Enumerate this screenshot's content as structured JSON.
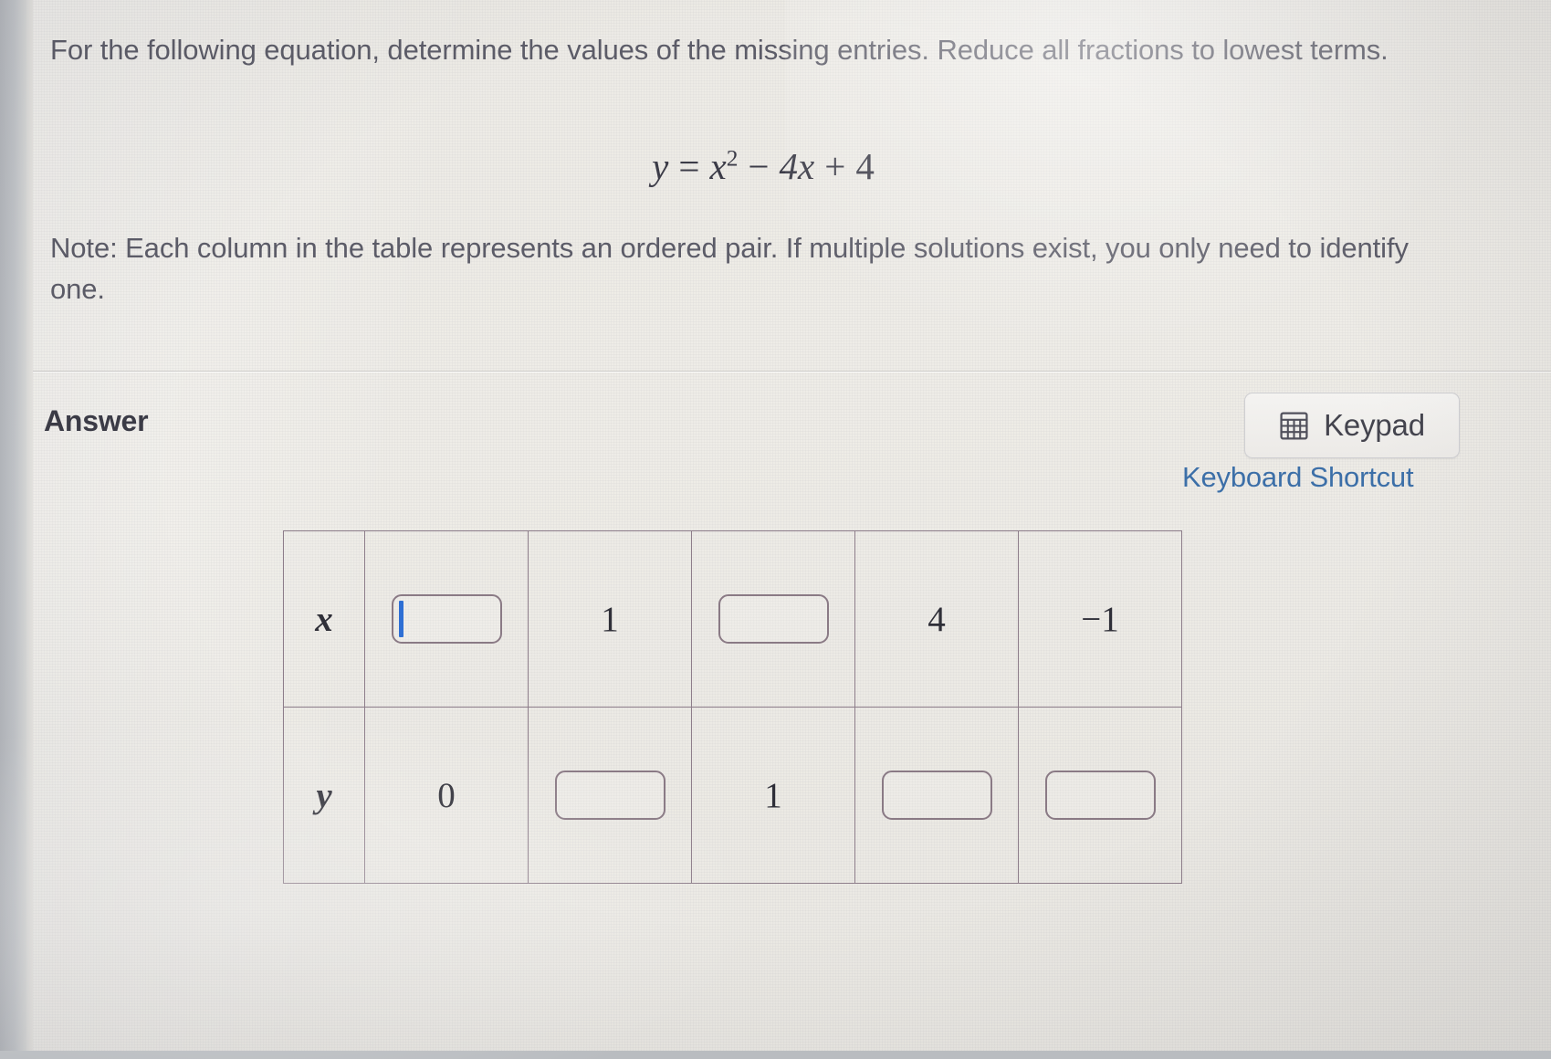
{
  "problem": {
    "instruction": "For the following equation, determine the values of the missing entries. Reduce all fractions to lowest terms.",
    "equation": {
      "lhs": "y",
      "relation": "=",
      "term1_base": "x",
      "term1_exp": "2",
      "op1": "−",
      "term2": "4x",
      "op2": "+",
      "term3": "4",
      "plain": "y = x² − 4x + 4"
    },
    "note": "Note: Each column in the table represents an ordered pair. If multiple solutions exist, you only need to identify one."
  },
  "answer_section": {
    "heading": "Answer",
    "keypad_button": {
      "label": "Keypad",
      "icon": "keypad-grid-icon"
    },
    "keyboard_shortcut_link": "Keyboard Shortcut"
  },
  "table": {
    "row_labels": [
      "x",
      "y"
    ],
    "rows": [
      {
        "label": "x",
        "cells": [
          {
            "type": "input",
            "value": "",
            "focused": true
          },
          {
            "type": "text",
            "value": "1"
          },
          {
            "type": "input",
            "value": "",
            "focused": false
          },
          {
            "type": "text",
            "value": "4"
          },
          {
            "type": "text",
            "value": "−1"
          }
        ]
      },
      {
        "label": "y",
        "cells": [
          {
            "type": "text",
            "value": "0"
          },
          {
            "type": "input",
            "value": "",
            "focused": false
          },
          {
            "type": "text",
            "value": "1"
          },
          {
            "type": "input",
            "value": "",
            "focused": false
          },
          {
            "type": "input",
            "value": "",
            "focused": false
          }
        ]
      }
    ]
  },
  "colors": {
    "link": "#3c6fa8",
    "caret": "#2e6fd4",
    "table_border": "#8d7d8a",
    "text": "#5c5c68"
  }
}
